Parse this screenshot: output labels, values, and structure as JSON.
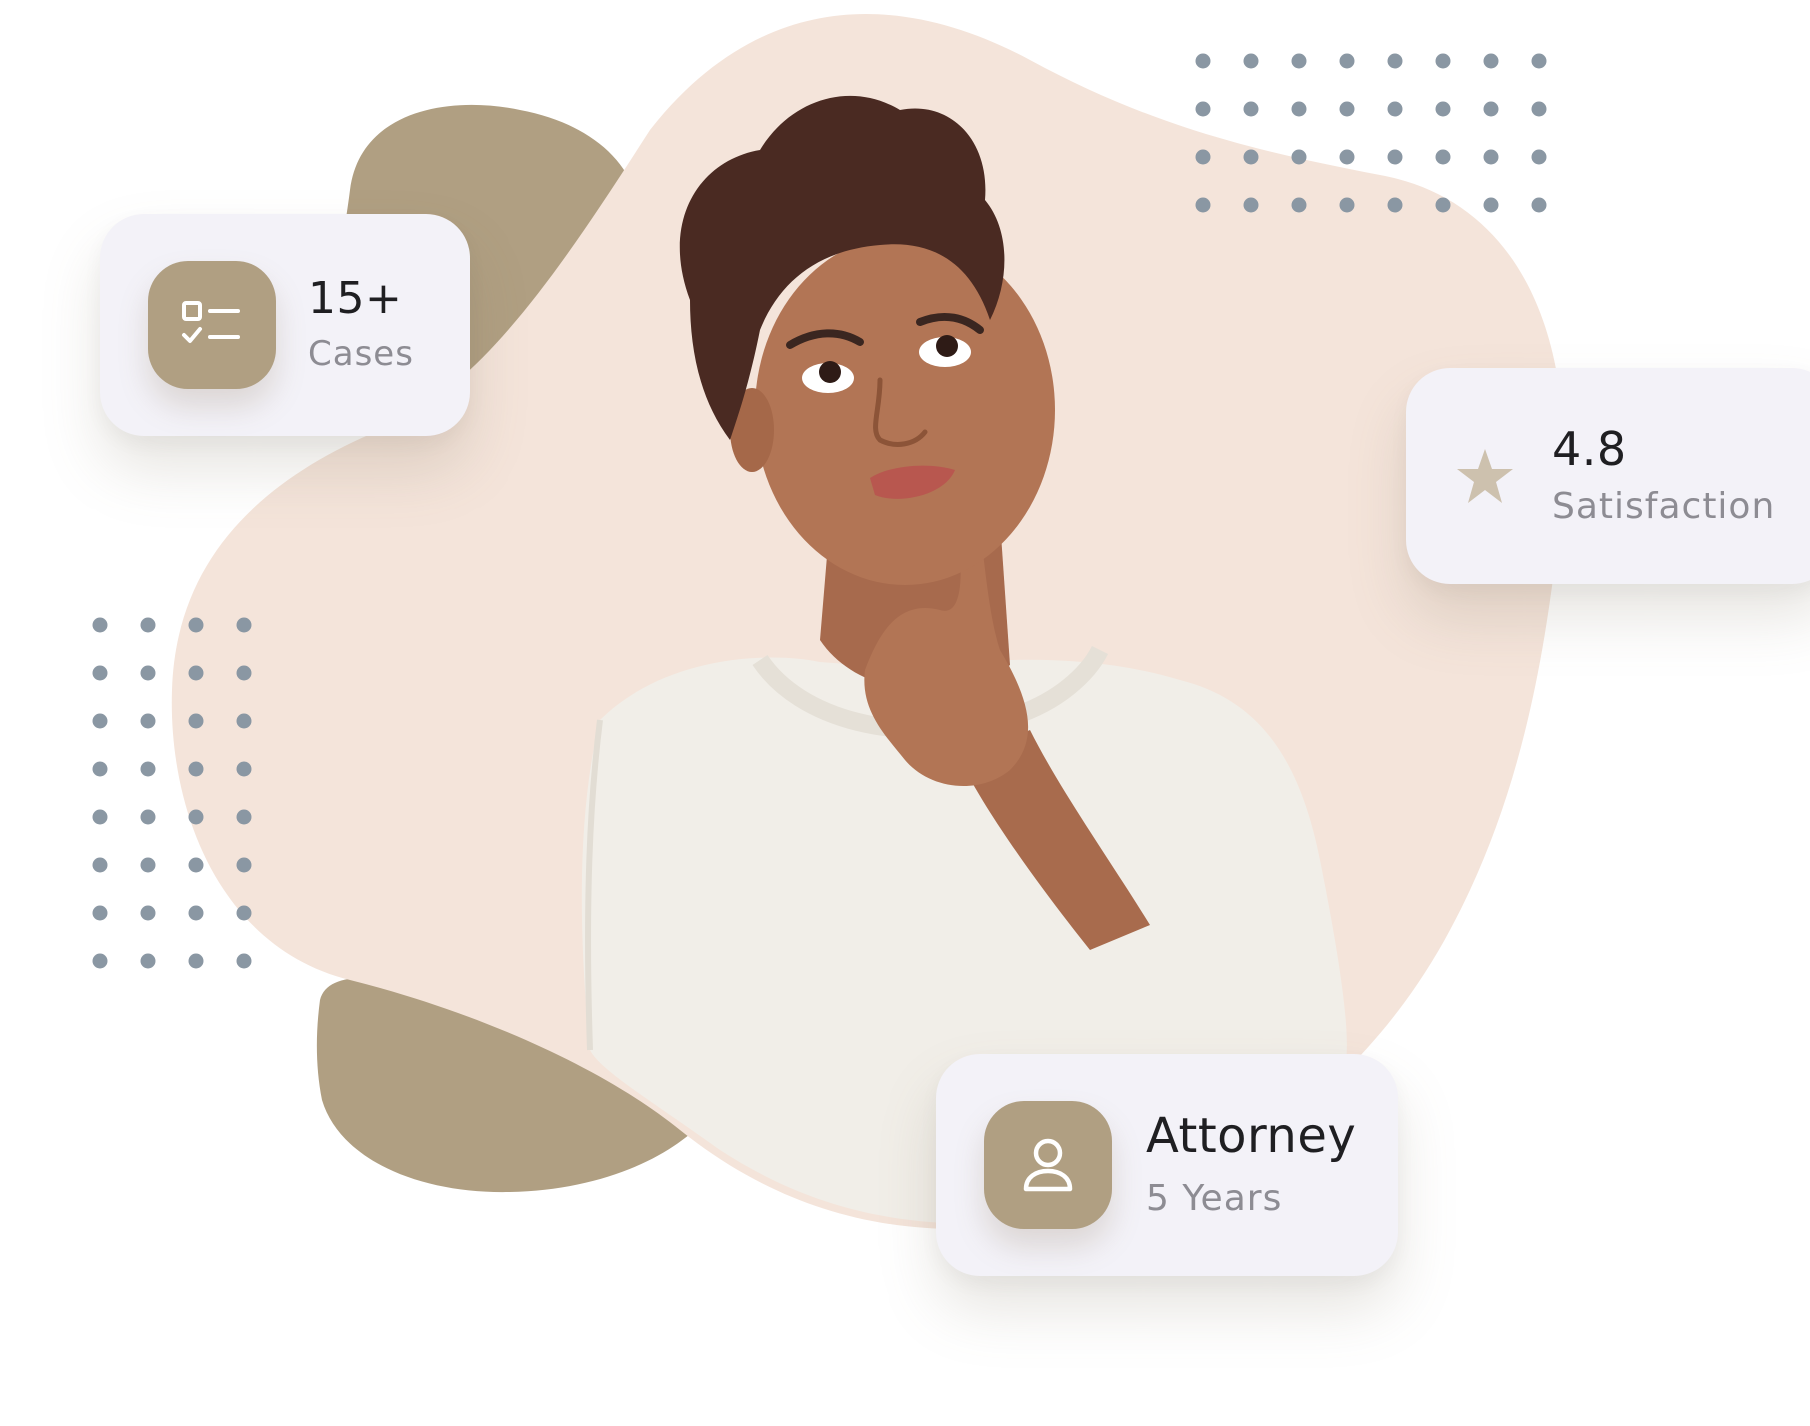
{
  "colors": {
    "accent": "#b09f82",
    "blob_light": "#f4e4da",
    "dots": "#8a97a3",
    "card_bg": "#f3f2f8"
  },
  "stats": {
    "cases": {
      "value": "15+",
      "label": "Cases",
      "icon": "checklist-icon"
    },
    "rating": {
      "value": "4.8",
      "label": "Satisfaction",
      "icon": "star-icon"
    },
    "attorney": {
      "value": "Attorney",
      "label": "5 Years",
      "icon": "user-icon"
    }
  }
}
